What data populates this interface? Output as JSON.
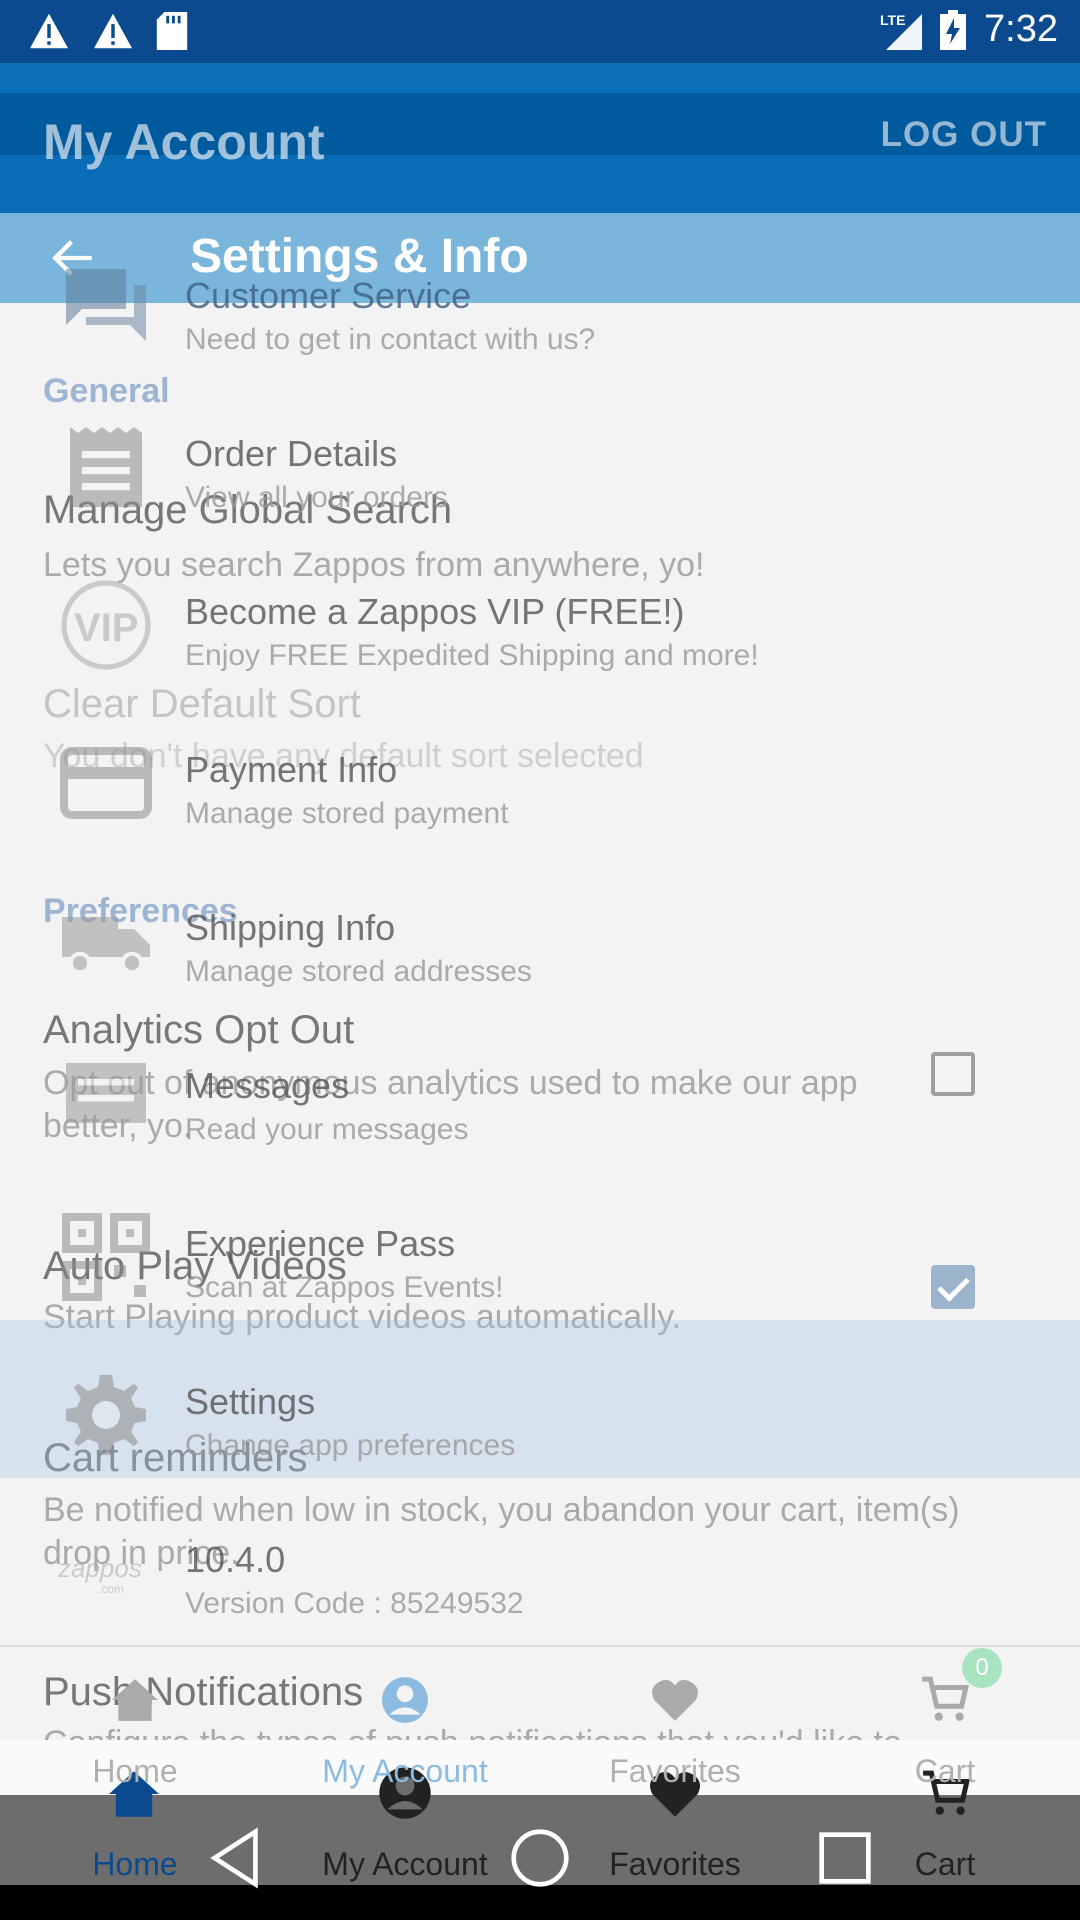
{
  "status_bar": {
    "time": "7:32",
    "network": "LTE",
    "icons": [
      "warning-icon",
      "warning-icon",
      "sd-card-icon",
      "signal-icon",
      "battery-charging-icon"
    ]
  },
  "account": {
    "title": "My Account",
    "logout_label": "LOG OUT",
    "sections": {
      "general": "General",
      "preferences": "Preferences"
    },
    "items": {
      "global_search": {
        "title": "Manage Global Search",
        "subtitle": "Lets you search Zappos from anywhere, yo!"
      },
      "default_sort": {
        "title": "Clear Default Sort",
        "subtitle": "You don't have any default sort selected"
      },
      "analytics": {
        "title": "Analytics Opt Out",
        "subtitle": "Opt out of anonymous analytics used to make our app better, yo.",
        "checked": false
      },
      "autoplay": {
        "title": "Auto Play Videos",
        "subtitle": "Start Playing product videos automatically.",
        "checked": true
      },
      "cart_reminders": {
        "title": "Cart reminders",
        "subtitle": "Be notified when low in stock, you abandon your cart, item(s) drop in price."
      },
      "push": {
        "title": "Push Notifications",
        "subtitle": "Configure the types of push notifications that you'd like to"
      }
    },
    "bottom_nav": [
      "Home",
      "My Account",
      "Favorites",
      "Cart"
    ]
  },
  "settings": {
    "title": "Settings & Info",
    "rows": [
      {
        "title": "Customer Service",
        "subtitle": "Need to get in contact with us?",
        "icon": "chat-icon"
      },
      {
        "title": "Order Details",
        "subtitle": "View all your orders",
        "icon": "receipt-icon"
      },
      {
        "title": "Become a Zappos VIP (FREE!)",
        "subtitle": "Enjoy FREE Expedited Shipping and more!",
        "icon": "vip-icon"
      },
      {
        "title": "Payment Info",
        "subtitle": "Manage stored payment",
        "icon": "credit-card-icon"
      },
      {
        "title": "Shipping Info",
        "subtitle": "Manage stored addresses",
        "icon": "truck-icon"
      },
      {
        "title": "Messages",
        "subtitle": "Read your messages",
        "icon": "message-icon"
      },
      {
        "title": "Experience Pass",
        "subtitle": "Scan at Zappos Events!",
        "icon": "qr-code-icon"
      },
      {
        "title": "Settings",
        "subtitle": "Change app preferences",
        "icon": "gear-icon"
      },
      {
        "title": "10.4.0",
        "subtitle": "Version Code : 85249532",
        "icon": "zappos-logo-icon"
      }
    ],
    "bottom_nav": [
      "Home",
      "My Account",
      "Favorites",
      "Cart"
    ],
    "cart_count": "0",
    "active_tab": "My Account"
  },
  "colors": {
    "status_bar": "#0b4a8e",
    "appbar": "#005a9e",
    "overlay_appbar": "#7ab6dc",
    "section_header": "#9db4d3",
    "badge": "#a8e4c0"
  }
}
